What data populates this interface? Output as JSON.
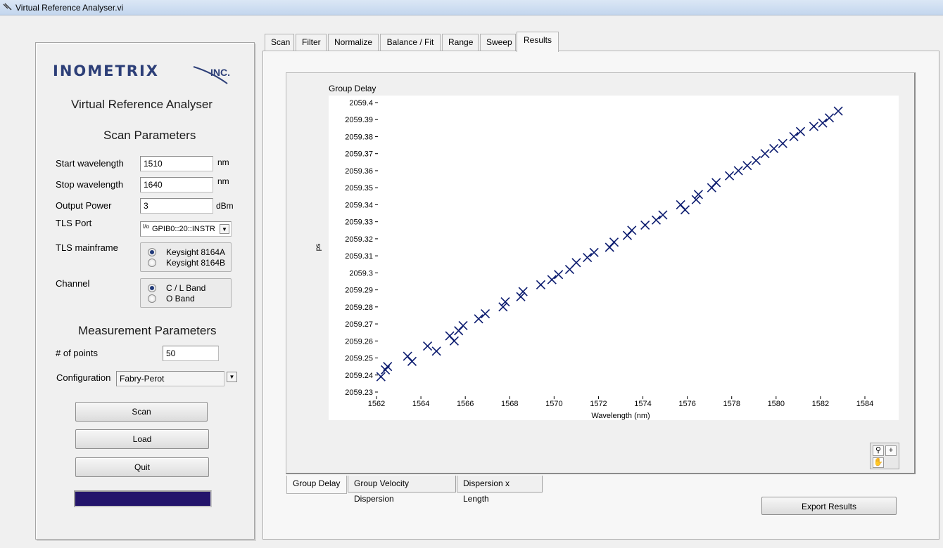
{
  "window": {
    "title": "Virtual Reference Analyser.vi"
  },
  "left_panel": {
    "logo_text": "INOMETRIX",
    "logo_suffix": "INC.",
    "app_title": "Virtual Reference Analyser",
    "scan_params_heading": "Scan Parameters",
    "start_wavelength": {
      "label": "Start wavelength",
      "value": "1510",
      "unit": "nm"
    },
    "stop_wavelength": {
      "label": "Stop wavelength",
      "value": "1640",
      "unit": "nm"
    },
    "output_power": {
      "label": "Output Power",
      "value": "3",
      "unit": "dBm"
    },
    "tls_port": {
      "label": "TLS Port",
      "value": "GPIB0::20::INSTR",
      "io_glyph": "I/o"
    },
    "tls_mainframe": {
      "label": "TLS mainframe",
      "options": [
        "Keysight 8164A",
        "Keysight 8164B"
      ],
      "selected": 0
    },
    "channel": {
      "label": "Channel",
      "options": [
        "C / L Band",
        "O Band"
      ],
      "selected": 0
    },
    "meas_params_heading": "Measurement Parameters",
    "num_points": {
      "label": "# of points",
      "value": "50"
    },
    "configuration": {
      "label": "Configuration",
      "value": "Fabry-Perot"
    },
    "buttons": {
      "scan": "Scan",
      "load": "Load",
      "quit": "Quit"
    },
    "progress": {
      "fraction": 1.0,
      "color": "#23146b"
    }
  },
  "tabs": {
    "items": [
      "Scan",
      "Filter",
      "Normalize",
      "Balance / Fit",
      "Range",
      "Sweep",
      "Results"
    ],
    "active": 6
  },
  "results": {
    "subtabs": [
      "Group Delay",
      "Group Velocity Dispersion",
      "Dispersion x Length"
    ],
    "active_subtab": 0,
    "export_button": "Export Results",
    "graph_tools": [
      "zoom-icon",
      "cursor-crosshair-icon",
      "pan-hand-icon"
    ]
  },
  "chart_data": {
    "type": "scatter",
    "title": "Group Delay",
    "xlabel": "Wavelength (nm)",
    "ylabel": "ps",
    "xlim": [
      1562,
      1584
    ],
    "ylim": [
      2059.23,
      2059.4
    ],
    "xticks": [
      1562,
      1564,
      1566,
      1568,
      1570,
      1572,
      1574,
      1576,
      1578,
      1580,
      1582,
      1584
    ],
    "yticks": [
      "2059.4",
      "2059.39",
      "2059.38",
      "2059.37",
      "2059.36",
      "2059.35",
      "2059.34",
      "2059.33",
      "2059.32",
      "2059.31",
      "2059.3",
      "2059.29",
      "2059.28",
      "2059.27",
      "2059.26",
      "2059.25",
      "2059.24",
      "2059.23"
    ],
    "grid": false,
    "marker": "x",
    "marker_color": "#0a1a6e",
    "x": [
      1562.2,
      1562.4,
      1562.5,
      1563.4,
      1563.6,
      1564.3,
      1564.7,
      1565.3,
      1565.5,
      1565.7,
      1565.9,
      1566.6,
      1566.9,
      1567.7,
      1567.8,
      1568.5,
      1568.6,
      1569.4,
      1569.9,
      1570.2,
      1570.7,
      1571.0,
      1571.5,
      1571.8,
      1572.5,
      1572.7,
      1573.3,
      1573.5,
      1574.1,
      1574.6,
      1574.9,
      1575.7,
      1575.9,
      1576.4,
      1576.5,
      1577.1,
      1577.3,
      1577.9,
      1578.3,
      1578.7,
      1579.1,
      1579.5,
      1579.9,
      1580.3,
      1580.8,
      1581.1,
      1581.7,
      1582.1,
      1582.4,
      1582.8
    ],
    "y": [
      2059.239,
      2059.243,
      2059.245,
      2059.251,
      2059.248,
      2059.257,
      2059.254,
      2059.263,
      2059.26,
      2059.266,
      2059.269,
      2059.273,
      2059.276,
      2059.28,
      2059.283,
      2059.286,
      2059.289,
      2059.293,
      2059.296,
      2059.299,
      2059.302,
      2059.306,
      2059.309,
      2059.312,
      2059.315,
      2059.318,
      2059.322,
      2059.325,
      2059.328,
      2059.331,
      2059.334,
      2059.34,
      2059.337,
      2059.343,
      2059.346,
      2059.35,
      2059.353,
      2059.357,
      2059.36,
      2059.363,
      2059.366,
      2059.37,
      2059.373,
      2059.376,
      2059.38,
      2059.383,
      2059.386,
      2059.388,
      2059.391,
      2059.395
    ]
  }
}
